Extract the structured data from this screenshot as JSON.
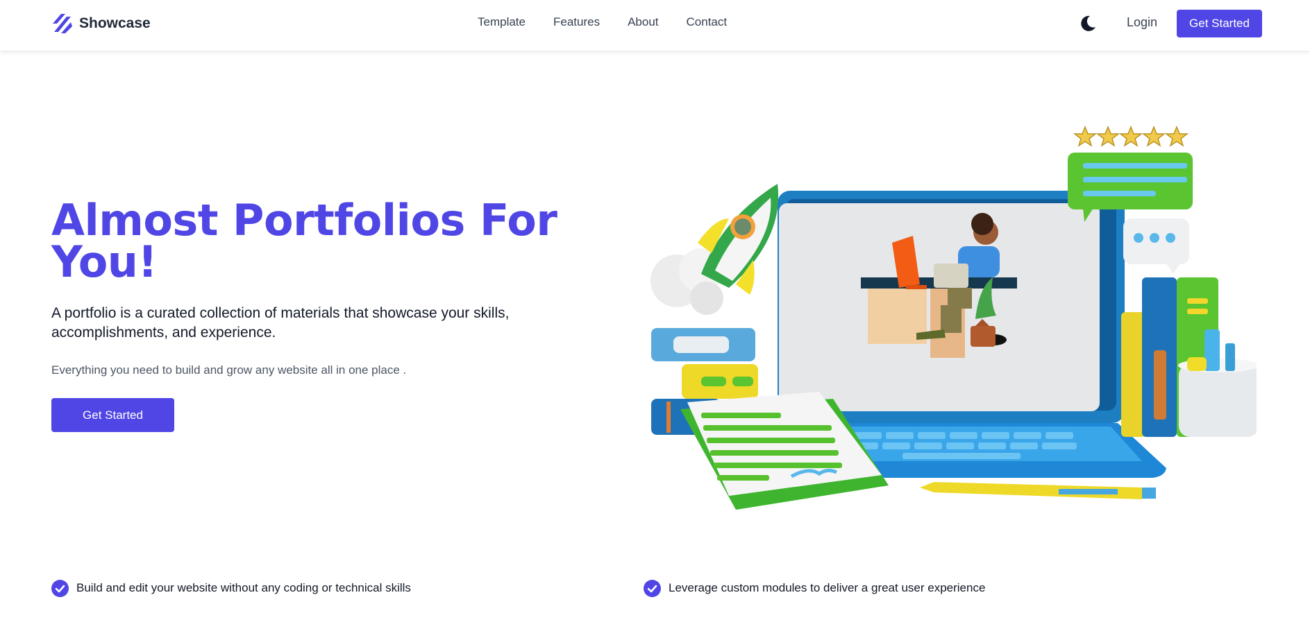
{
  "header": {
    "brand": "Showcase",
    "nav": [
      {
        "label": "Template"
      },
      {
        "label": "Features"
      },
      {
        "label": "About"
      },
      {
        "label": "Contact"
      }
    ],
    "theme_icon": "moon-icon",
    "login_label": "Login",
    "cta_label": "Get Started"
  },
  "hero": {
    "title": "Almost Portfolios For You!",
    "lead": "A portfolio is a curated collection of materials that showcase your skills, accomplishments, and experience.",
    "subtext": "Everything you need to build and grow any website all in one place .",
    "cta_label": "Get Started",
    "illustration_icon": "laptop-workspace-illustration"
  },
  "features": [
    {
      "icon": "check-circle-icon",
      "text": "Build and edit your website without any coding or technical skills"
    },
    {
      "icon": "check-circle-icon",
      "text": "Leverage custom modules to deliver a great user experience"
    }
  ],
  "colors": {
    "accent": "#4f46e5",
    "text": "#111827",
    "muted": "#4b5563"
  }
}
